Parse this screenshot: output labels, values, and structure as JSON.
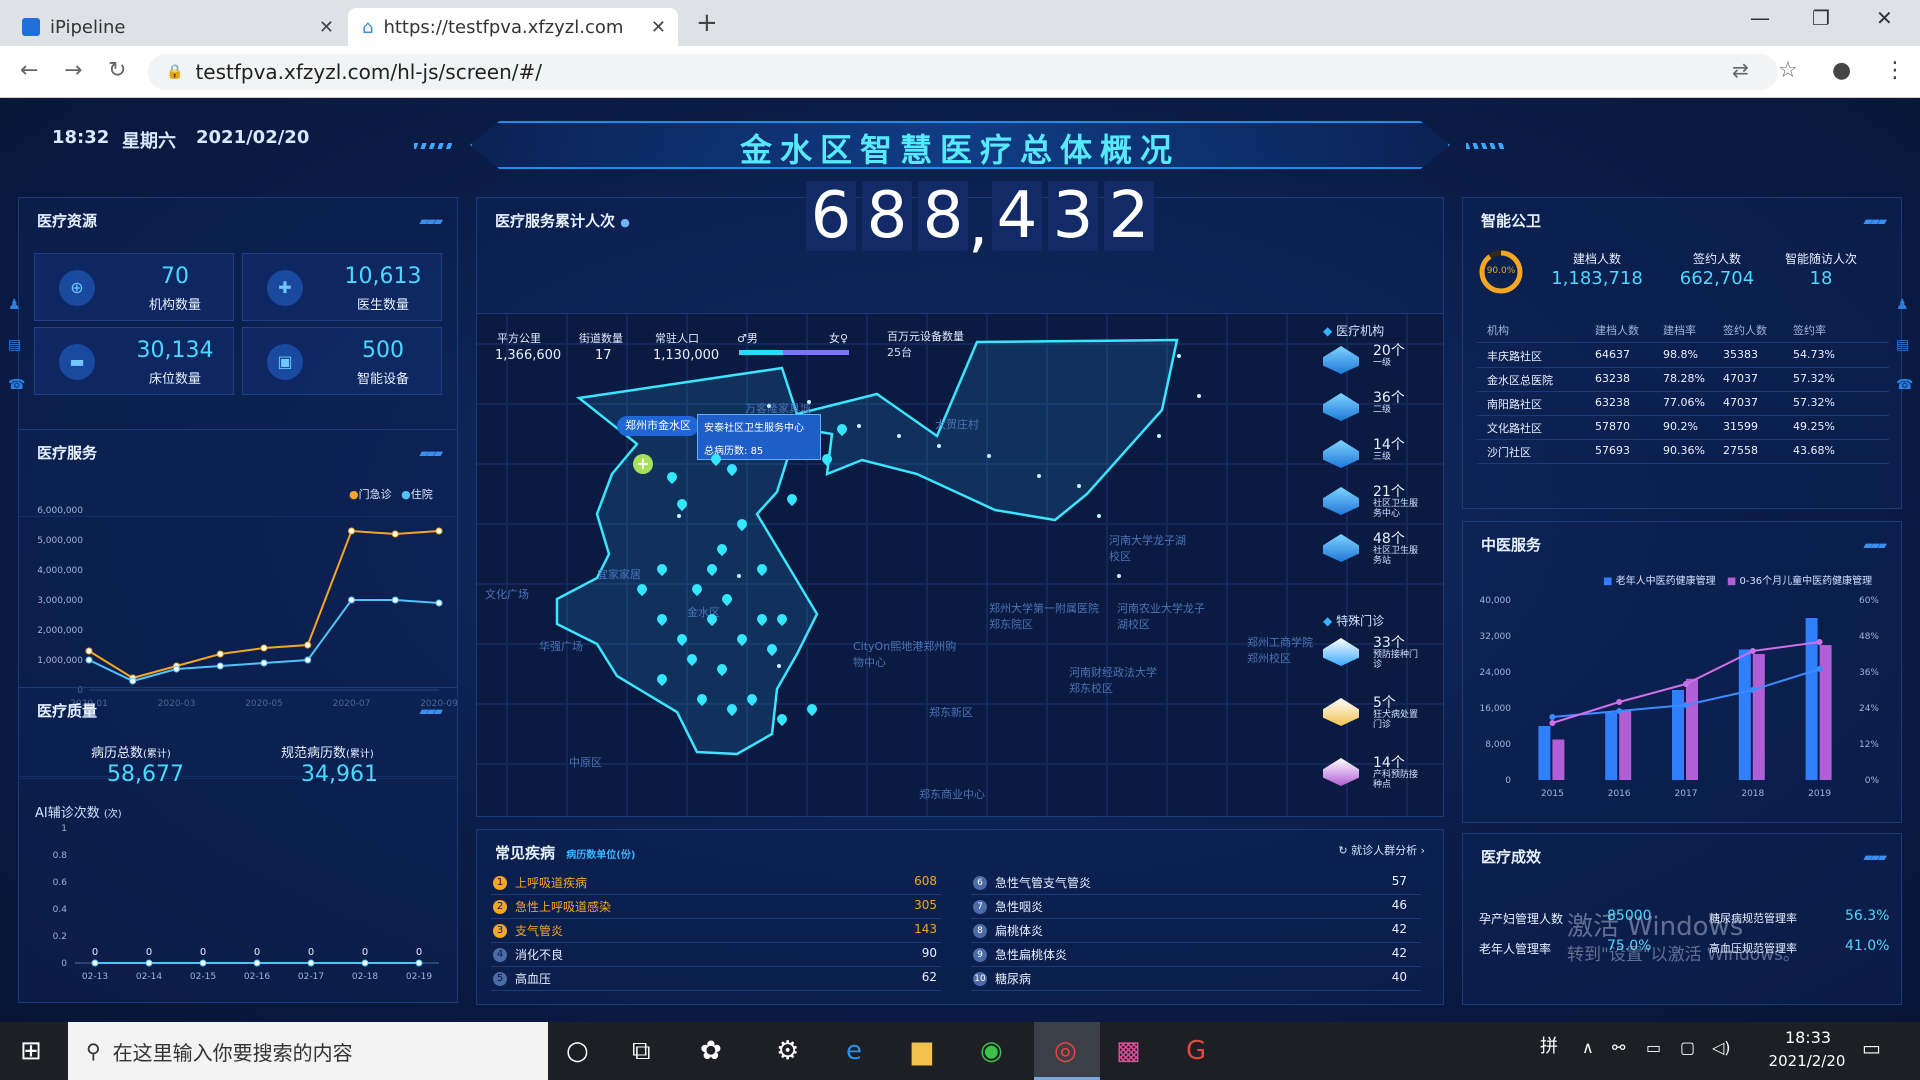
{
  "browser": {
    "tab1": {
      "title": "iPipeline"
    },
    "tab2": {
      "title": "https://testfpva.xfzyzl.com/hl-j"
    },
    "url": "testfpva.xfzyzl.com/hl-js/screen/#/"
  },
  "header": {
    "time": "18:32",
    "weekday": "星期六",
    "date": "2021/02/20",
    "title": "金水区智慧医疗总体概况"
  },
  "resources": {
    "title": "医疗资源",
    "items": [
      {
        "value": "70",
        "label": "机构数量",
        "icon": "hospital-icon"
      },
      {
        "value": "10,613",
        "label": "医生数量",
        "icon": "doctor-icon"
      },
      {
        "value": "30,134",
        "label": "床位数量",
        "icon": "bed-icon"
      },
      {
        "value": "500",
        "label": "智能设备",
        "icon": "device-icon"
      }
    ]
  },
  "service": {
    "title": "医疗服务",
    "legend": [
      "门急诊",
      "住院"
    ],
    "chart_data": {
      "type": "line",
      "x": [
        "2020-01",
        "2020-02",
        "2020-03",
        "2020-04",
        "2020-05",
        "2020-06",
        "2020-07",
        "2020-08",
        "2020-09"
      ],
      "x_ticks": [
        "2020-01",
        "2020-03",
        "2020-05",
        "2020-07",
        "2020-09"
      ],
      "y_ticks": [
        "0",
        "1,000,000",
        "2,000,000",
        "3,000,000",
        "4,000,000",
        "5,000,000",
        "6,000,000"
      ],
      "ylim": [
        0,
        6000000
      ],
      "series": [
        {
          "name": "门急诊",
          "color": "#f5a623",
          "values": [
            1300000,
            400000,
            800000,
            1200000,
            1400000,
            1500000,
            5300000,
            5200000,
            5300000
          ]
        },
        {
          "name": "住院",
          "color": "#4fc3f7",
          "values": [
            1000000,
            300000,
            700000,
            800000,
            900000,
            1000000,
            3000000,
            3000000,
            2900000
          ]
        }
      ]
    }
  },
  "quality": {
    "title": "医疗质量",
    "total_label": "病历总数",
    "total_tag": "(累计)",
    "total_value": "58,677",
    "std_label": "规范病历数",
    "std_tag": "(累计)",
    "std_value": "34,961",
    "ai_label": "AI辅诊次数",
    "ai_unit": "(次)",
    "chart_data": {
      "type": "line",
      "x": [
        "02-13",
        "02-14",
        "02-15",
        "02-16",
        "02-17",
        "02-18",
        "02-19"
      ],
      "y_ticks": [
        "0",
        "0.2",
        "0.4",
        "0.6",
        "0.8",
        "1"
      ],
      "ylim": [
        0,
        1
      ],
      "series": [
        {
          "color": "#4fc3f7",
          "values": [
            0,
            0,
            0,
            0,
            0,
            0,
            0
          ]
        }
      ]
    }
  },
  "center": {
    "total_label": "医疗服务累计人次",
    "digits": [
      "6",
      "8",
      "8",
      ",",
      "4",
      "3",
      "2"
    ],
    "map_stats": [
      {
        "label": "平方公里",
        "value": "1,366,600"
      },
      {
        "label": "街道数量",
        "value": "17"
      },
      {
        "label": "常驻人口",
        "value": "1,130,000"
      }
    ],
    "gender": {
      "male": "男",
      "female": "女"
    },
    "equip": {
      "label": "百万元设备数量",
      "value": "25台"
    },
    "map_popup": {
      "region": "郑州市金水区",
      "name": "安泰社区卫生服务中心",
      "count_label": "总病历数:",
      "count": "85"
    },
    "map_labels": [
      "万客隆家具城",
      "大贺庄村",
      "河南大学龙子湖校区",
      "郑州大学第一附属医院郑东院区",
      "河南农业大学龙子湖校区",
      "郑州工商学院郑州校区",
      "河南财经政法大学郑东校区",
      "郑东新区",
      "CityOn熙地港郑州购物中心",
      "文化广场",
      "宜家家居",
      "华强广场",
      "中原区",
      "郑东商业中心",
      "金水区"
    ],
    "institutions_title": "医疗机构",
    "institutions": [
      {
        "count": "20个",
        "label": "一级"
      },
      {
        "count": "36个",
        "label": "二级"
      },
      {
        "count": "14个",
        "label": "三级"
      },
      {
        "count": "21个",
        "label": "社区卫生服务中心"
      },
      {
        "count": "48个",
        "label": "社区卫生服务站"
      }
    ],
    "special_title": "特殊门诊",
    "special": [
      {
        "count": "33个",
        "label": "预防接种门诊"
      },
      {
        "count": "5个",
        "label": "狂犬病处置门诊"
      },
      {
        "count": "14个",
        "label": "产科预防接种点"
      }
    ]
  },
  "diseases": {
    "title": "常见疾病",
    "unit": "病历数单位(份)",
    "link": "就诊人群分析",
    "left": [
      {
        "rank": "1",
        "name": "上呼吸道疾病",
        "value": "608"
      },
      {
        "rank": "2",
        "name": "急性上呼吸道感染",
        "value": "305"
      },
      {
        "rank": "3",
        "name": "支气管炎",
        "value": "143"
      },
      {
        "rank": "4",
        "name": "消化不良",
        "value": "90"
      },
      {
        "rank": "5",
        "name": "高血压",
        "value": "62"
      }
    ],
    "right": [
      {
        "rank": "6",
        "name": "急性气管支气管炎",
        "value": "57"
      },
      {
        "rank": "7",
        "name": "急性咽炎",
        "value": "46"
      },
      {
        "rank": "8",
        "name": "扁桃体炎",
        "value": "42"
      },
      {
        "rank": "9",
        "name": "急性扁桃体炎",
        "value": "42"
      },
      {
        "rank": "10",
        "name": "糖尿病",
        "value": "40"
      }
    ]
  },
  "gongwei": {
    "title": "智能公卫",
    "ring": "90.0%",
    "stats": [
      {
        "label": "建档人数",
        "value": "1,183,718"
      },
      {
        "label": "签约人数",
        "value": "662,704"
      },
      {
        "label": "智能随访人次",
        "value": "18"
      }
    ],
    "headers": [
      "机构",
      "建档人数",
      "建档率",
      "签约人数",
      "签约率"
    ],
    "rows": [
      [
        "丰庆路社区",
        "64637",
        "98.8%",
        "35383",
        "54.73%"
      ],
      [
        "金水区总医院",
        "63238",
        "78.28%",
        "47037",
        "57.32%"
      ],
      [
        "南阳路社区",
        "63238",
        "77.06%",
        "47037",
        "57.32%"
      ],
      [
        "文化路社区",
        "57870",
        "90.2%",
        "31599",
        "49.25%"
      ],
      [
        "沙门社区",
        "57693",
        "90.36%",
        "27558",
        "43.68%"
      ]
    ]
  },
  "tcm": {
    "title": "中医服务",
    "legend": [
      "老年人中医药健康管理",
      "0-36个月儿童中医药健康管理"
    ],
    "chart_data": {
      "type": "bar",
      "categories": [
        "2015",
        "2016",
        "2017",
        "2018",
        "2019"
      ],
      "y_ticks": [
        "0",
        "8,000",
        "16,000",
        "24,000",
        "32,000",
        "40,000"
      ],
      "y2_ticks": [
        "0%",
        "12%",
        "24%",
        "36%",
        "48%",
        "60%"
      ],
      "ylim": [
        0,
        40000
      ],
      "series": [
        {
          "name": "老年人中医药健康管理",
          "color": "#2f7fff",
          "values": [
            12000,
            15000,
            20000,
            29000,
            36000
          ]
        },
        {
          "name": "0-36个月儿童中医药健康管理",
          "color": "#b15fd6",
          "values": [
            9000,
            15500,
            22500,
            28000,
            30000
          ]
        }
      ],
      "lines": [
        {
          "color": "#3d8bff",
          "values": [
            0.21,
            0.23,
            0.25,
            0.3,
            0.37
          ]
        },
        {
          "color": "#d070e8",
          "values": [
            0.19,
            0.26,
            0.32,
            0.43,
            0.46
          ]
        }
      ]
    }
  },
  "effect": {
    "title": "医疗成效",
    "items": [
      {
        "label": "孕产妇管理人数",
        "value": "85000"
      },
      {
        "label": "糖尿病规范管理率",
        "value": "56.3%"
      },
      {
        "label": "老年人管理率",
        "value": "75.0%"
      },
      {
        "label": "高血压规范管理率",
        "value": "41.0%"
      }
    ],
    "watermark1": "激活 Windows",
    "watermark2": "转到\"设置\"以激活 Windows。"
  },
  "taskbar": {
    "search": "在这里输入你要搜索的内容",
    "ime": "拼",
    "time": "18:33",
    "date": "2021/2/20"
  }
}
